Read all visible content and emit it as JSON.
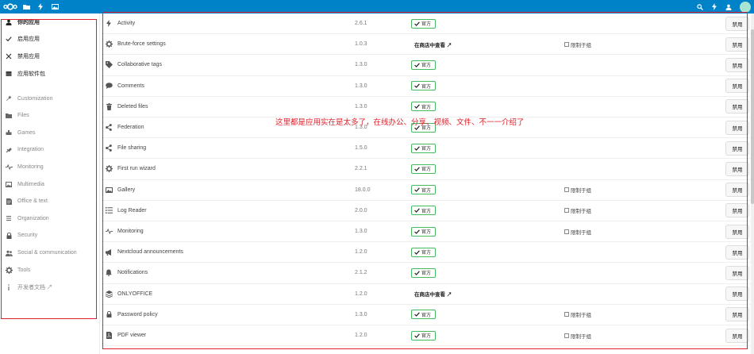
{
  "header": {
    "apps": [
      "files-icon",
      "activity-icon",
      "gallery-icon"
    ],
    "right_icons": [
      "search-icon",
      "notifications-icon",
      "contacts-icon"
    ]
  },
  "sidebar": {
    "top_items": [
      {
        "label": "你的应用",
        "icon": "user-icon",
        "active": true
      },
      {
        "label": "启用应用",
        "icon": "check-icon"
      },
      {
        "label": "禁用应用",
        "icon": "close-icon"
      },
      {
        "label": "应用软件包",
        "icon": "bundle-icon"
      }
    ],
    "categories": [
      {
        "label": "Customization",
        "icon": "wrench-icon"
      },
      {
        "label": "Files",
        "icon": "folder-icon"
      },
      {
        "label": "Games",
        "icon": "games-icon"
      },
      {
        "label": "Integration",
        "icon": "integration-icon"
      },
      {
        "label": "Monitoring",
        "icon": "monitoring-icon"
      },
      {
        "label": "Multimedia",
        "icon": "multimedia-icon"
      },
      {
        "label": "Office & text",
        "icon": "document-icon"
      },
      {
        "label": "Organization",
        "icon": "organization-icon"
      },
      {
        "label": "Security",
        "icon": "lock-icon"
      },
      {
        "label": "Social & communication",
        "icon": "social-icon"
      },
      {
        "label": "Tools",
        "icon": "gear-icon"
      },
      {
        "label": "开发者文档 ↗",
        "icon": "info-icon"
      }
    ]
  },
  "apps": [
    {
      "name": "Activity",
      "icon": "activity-icon",
      "version": "2.6.1",
      "status": "official",
      "limit": false
    },
    {
      "name": "Brute-force settings",
      "icon": "gear-icon",
      "version": "1.0.3",
      "status": "store",
      "limit": true
    },
    {
      "name": "Collaborative tags",
      "icon": "tag-icon",
      "version": "1.3.0",
      "status": "official",
      "limit": false
    },
    {
      "name": "Comments",
      "icon": "comment-icon",
      "version": "1.3.0",
      "status": "official",
      "limit": false
    },
    {
      "name": "Deleted files",
      "icon": "trash-icon",
      "version": "1.3.0",
      "status": "official",
      "limit": false
    },
    {
      "name": "Federation",
      "icon": "share-icon",
      "version": "1.3.0",
      "status": "official",
      "limit": false
    },
    {
      "name": "File sharing",
      "icon": "share-icon",
      "version": "1.5.0",
      "status": "official",
      "limit": false
    },
    {
      "name": "First run wizard",
      "icon": "gear-icon",
      "version": "2.2.1",
      "status": "official",
      "limit": false
    },
    {
      "name": "Gallery",
      "icon": "gallery-icon",
      "version": "18.0.0",
      "status": "official",
      "limit": true
    },
    {
      "name": "Log Reader",
      "icon": "list-icon",
      "version": "2.0.0",
      "status": "official",
      "limit": true
    },
    {
      "name": "Monitoring",
      "icon": "monitoring-icon",
      "version": "1.3.0",
      "status": "official",
      "limit": true
    },
    {
      "name": "Nextcloud announcements",
      "icon": "megaphone-icon",
      "version": "1.2.0",
      "status": "official",
      "limit": false
    },
    {
      "name": "Notifications",
      "icon": "bell-icon",
      "version": "2.1.2",
      "status": "official",
      "limit": false
    },
    {
      "name": "ONLYOFFICE",
      "icon": "layers-icon",
      "version": "1.2.0",
      "status": "store",
      "limit": false
    },
    {
      "name": "Password policy",
      "icon": "lock-icon",
      "version": "1.3.0",
      "status": "official",
      "limit": true
    },
    {
      "name": "PDF viewer",
      "icon": "pdf-icon",
      "version": "1.2.0",
      "status": "official",
      "limit": true
    }
  ],
  "labels": {
    "official": "官方",
    "store": "在商店中查看 ↗",
    "limit": "限制于组",
    "disable": "禁用"
  },
  "annotation": "这里都是应用实在是太多了，在线办公、分享、视频、文件、不一一介绍了",
  "colors": {
    "header": "#0082c9",
    "official_border": "#46ba61",
    "annotation": "#e0202a"
  }
}
